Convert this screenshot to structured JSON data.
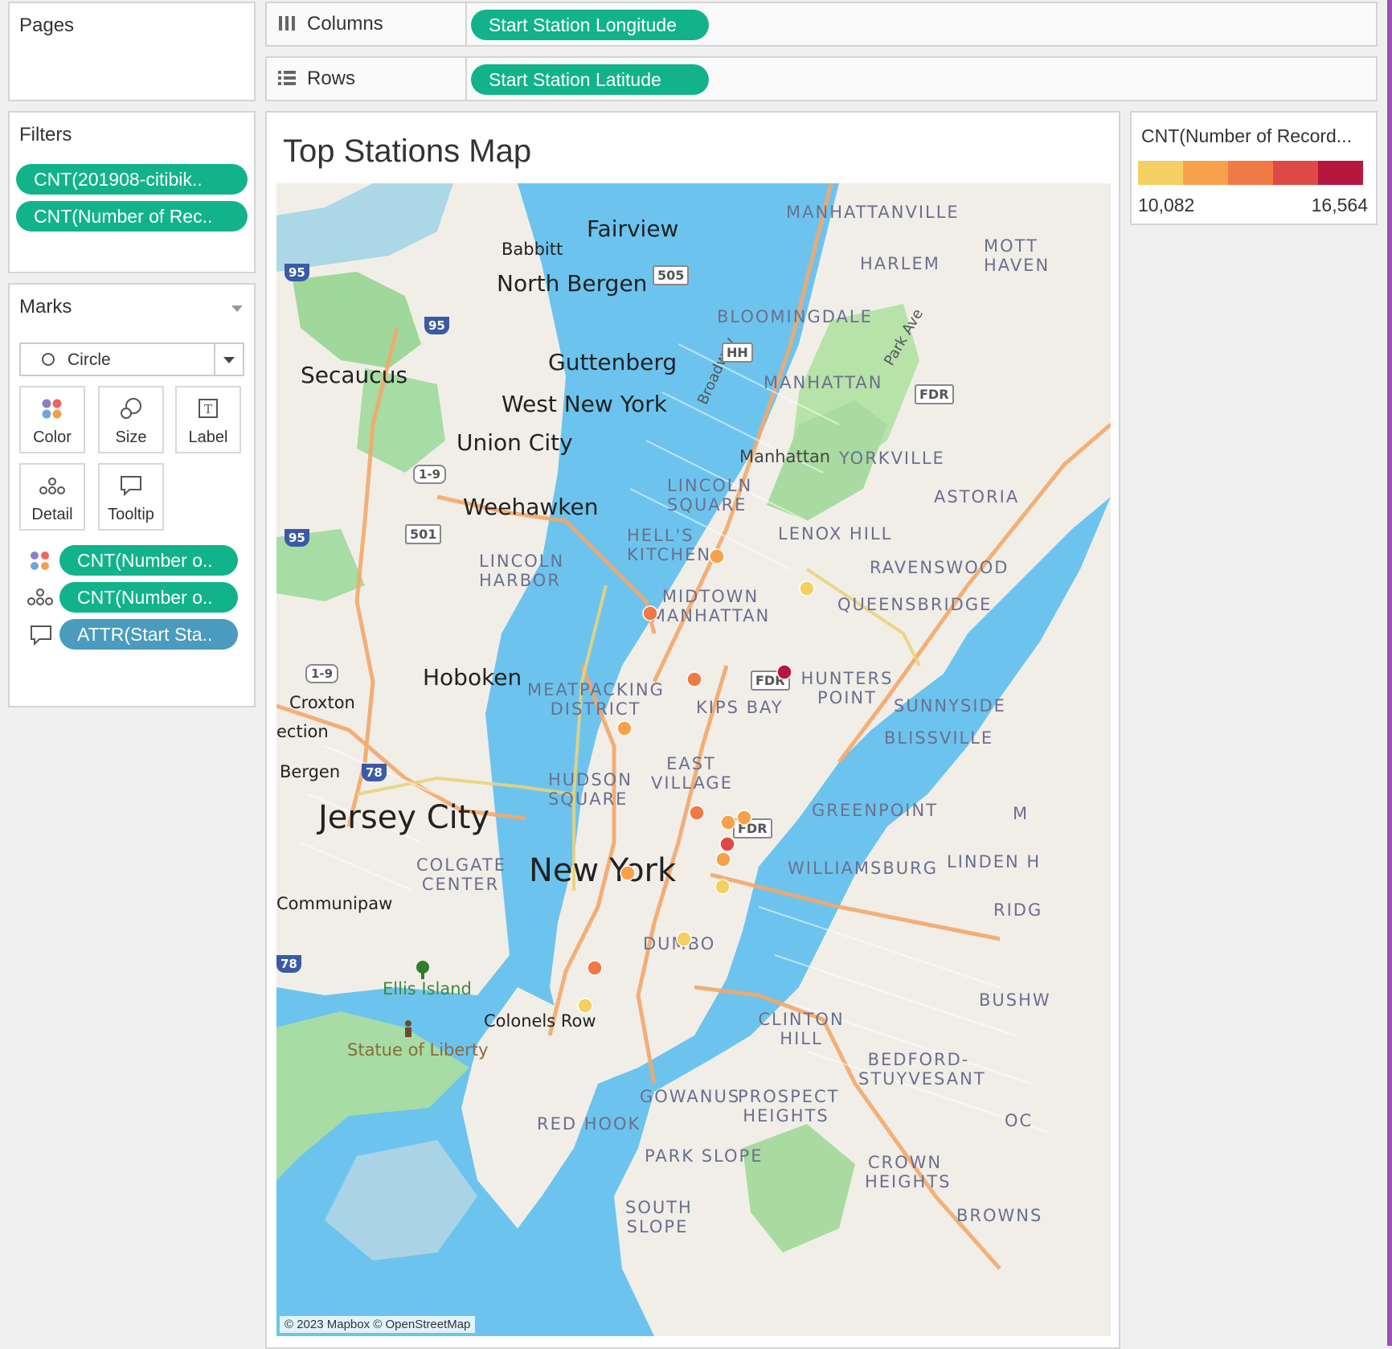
{
  "pages": {
    "title": "Pages"
  },
  "filters": {
    "title": "Filters",
    "items": [
      "CNT(201908-citibik..",
      "CNT(Number of Rec.."
    ]
  },
  "marks": {
    "title": "Marks",
    "type": "Circle",
    "buttons": [
      "Color",
      "Size",
      "Label",
      "Detail",
      "Tooltip"
    ],
    "fields": [
      "CNT(Number o..",
      "CNT(Number o..",
      "ATTR(Start Sta.."
    ]
  },
  "columns": {
    "label": "Columns",
    "field": "Start Station Longitude"
  },
  "rows": {
    "label": "Rows",
    "field": "Start Station Latitude"
  },
  "sheet": {
    "title": "Top Stations Map"
  },
  "legend": {
    "title": "CNT(Number of Record...",
    "min": "10,082",
    "max": "16,564",
    "colors": [
      "#f5cf62",
      "#f7a24a",
      "#ef7a45",
      "#dd4a45",
      "#b5173f"
    ]
  },
  "map": {
    "attribution": "© 2023 Mapbox © OpenStreetMap",
    "water_color": "#6cc4ee",
    "land_color": "#f1eee8",
    "neighborhoods": [
      "MANHATTANVILLE",
      "HARLEM",
      "MOTT HAVEN",
      "BLOOMINGDALE",
      "MANHATTAN",
      "Manhattan",
      "YORKVILLE",
      "LINCOLN SQUARE",
      "HELL'S KITCHEN",
      "LENOX HILL",
      "ASTORIA",
      "RAVENSWOOD",
      "QUEENSBRIDGE",
      "MIDTOWN MANHATTAN",
      "LINCOLN HARBOR",
      "MEATPACKING DISTRICT",
      "KIPS BAY",
      "HUNTERS POINT",
      "SUNNYSIDE",
      "BLISSVILLE",
      "EAST VILLAGE",
      "HUDSON SQUARE",
      "GREENPOINT",
      "WILLIAMSBURG",
      "LINDEN H",
      "COLGATE CENTER",
      "DUMBO",
      "CLINTON HILL",
      "BEDFORD-STUYVESANT",
      "GOWANUS",
      "PROSPECT HEIGHTS",
      "RED HOOK",
      "PARK SLOPE",
      "CROWN HEIGHTS",
      "SOUTH SLOPE",
      "BUSHW",
      "RIDG",
      "BROWNS",
      "OC",
      "M"
    ],
    "cities": [
      "Fairview",
      "Babbitt",
      "North Bergen",
      "Guttenberg",
      "West New York",
      "Secaucus",
      "Union City",
      "Weehawken",
      "Hoboken",
      "Croxton",
      "ection",
      "Bergen",
      "Jersey City",
      "Communipaw",
      "New York",
      "Ellis Island",
      "Statue of Liberty",
      "Colonels Row"
    ],
    "roads": [
      "Broadway",
      "Park Ave",
      "FDR",
      "HH",
      "505",
      "95",
      "1-9",
      "501",
      "78"
    ],
    "points": [
      {
        "name": "station-1",
        "count_level": 3,
        "color": "#ef7a45"
      },
      {
        "name": "station-2",
        "count_level": 2,
        "color": "#f7a24a"
      },
      {
        "name": "station-3",
        "count_level": 1,
        "color": "#f5cf62"
      },
      {
        "name": "station-4",
        "count_level": 3,
        "color": "#ef7a45"
      },
      {
        "name": "station-5",
        "count_level": 5,
        "color": "#b5173f"
      },
      {
        "name": "station-6",
        "count_level": 2,
        "color": "#f7a24a"
      },
      {
        "name": "station-7",
        "count_level": 3,
        "color": "#ef7a45"
      },
      {
        "name": "station-8",
        "count_level": 2,
        "color": "#f7a24a"
      },
      {
        "name": "station-9",
        "count_level": 2,
        "color": "#f7a24a"
      },
      {
        "name": "station-10",
        "count_level": 4,
        "color": "#dd4a45"
      },
      {
        "name": "station-11",
        "count_level": 2,
        "color": "#f7a24a"
      },
      {
        "name": "station-12",
        "count_level": 2,
        "color": "#f7a24a"
      },
      {
        "name": "station-13",
        "count_level": 1,
        "color": "#f5cf62"
      },
      {
        "name": "station-14",
        "count_level": 1,
        "color": "#f5cf62"
      },
      {
        "name": "station-15",
        "count_level": 3,
        "color": "#ef7a45"
      },
      {
        "name": "station-16",
        "count_level": 1,
        "color": "#f5cf62"
      }
    ]
  }
}
